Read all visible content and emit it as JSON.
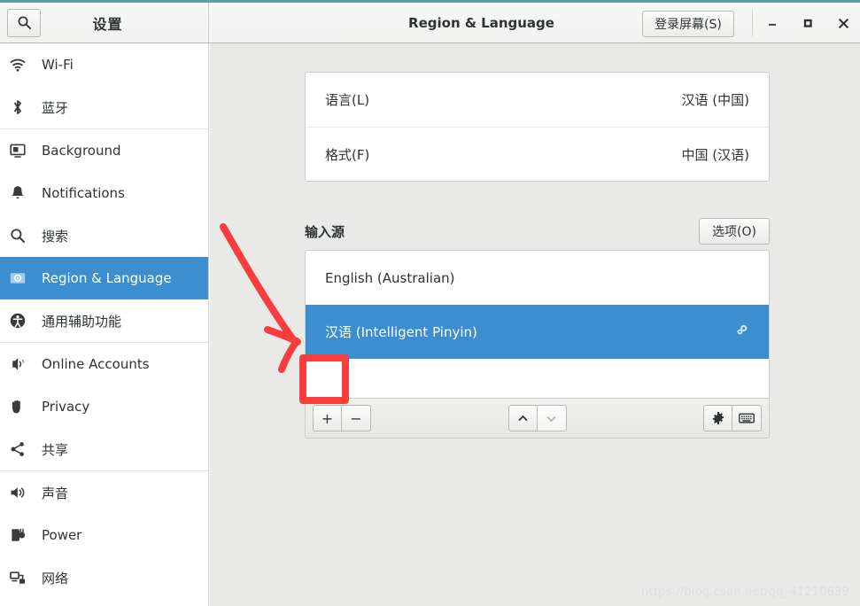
{
  "window": {
    "accent_color": "#5f9ea0",
    "selection_color": "#3c8ecf",
    "settings_title": "设置",
    "page_title": "Region & Language",
    "login_screen_button": "登录屏幕(S)",
    "minimize_label": "–",
    "maximize_label": "■",
    "close_label": "✕"
  },
  "sidebar": {
    "items": [
      {
        "label": "Wi-Fi",
        "icon": "wifi-icon",
        "selected": false,
        "sep_after": false
      },
      {
        "label": "蓝牙",
        "icon": "bluetooth-icon",
        "selected": false,
        "sep_after": true
      },
      {
        "label": "Background",
        "icon": "background-icon",
        "selected": false,
        "sep_after": false
      },
      {
        "label": "Notifications",
        "icon": "bell-icon",
        "selected": false,
        "sep_after": false
      },
      {
        "label": "搜索",
        "icon": "search-icon",
        "selected": false,
        "sep_after": false
      },
      {
        "label": "Region & Language",
        "icon": "region-language-icon",
        "selected": true,
        "sep_after": false
      },
      {
        "label": "通用辅助功能",
        "icon": "accessibility-icon",
        "selected": false,
        "sep_after": true
      },
      {
        "label": "Online Accounts",
        "icon": "online-accounts-icon",
        "selected": false,
        "sep_after": false
      },
      {
        "label": "Privacy",
        "icon": "privacy-hand-icon",
        "selected": false,
        "sep_after": false
      },
      {
        "label": "共享",
        "icon": "sharing-icon",
        "selected": false,
        "sep_after": true
      },
      {
        "label": "声音",
        "icon": "sound-icon",
        "selected": false,
        "sep_after": false
      },
      {
        "label": "Power",
        "icon": "power-plug-icon",
        "selected": false,
        "sep_after": false
      },
      {
        "label": "网络",
        "icon": "network-icon",
        "selected": false,
        "sep_after": false
      }
    ]
  },
  "main": {
    "language_rows": [
      {
        "label": "语言(L)",
        "value": "汉语 (中国)"
      },
      {
        "label": "格式(F)",
        "value": "中国 (汉语)"
      }
    ],
    "input_sources": {
      "section_title": "输入源",
      "options_button": "选项(O)",
      "rows": [
        {
          "label": "English (Australian)",
          "selected": false,
          "has_prefs_icon": false
        },
        {
          "label": "汉语 (Intelligent Pinyin)",
          "selected": true,
          "has_prefs_icon": true
        }
      ],
      "toolbar": {
        "add_label": "+",
        "remove_label": "−",
        "move_up_label": "⌃",
        "move_down_label": "⌄",
        "preferences_icon": "gear-icon",
        "keyboard_icon": "keyboard-icon"
      }
    }
  },
  "annotation": {
    "color": "#f93d3d",
    "type": "hand-drawn-arrow-and-box",
    "target": "add-input-source-button"
  },
  "watermark": {
    "text": "https://blog.csdn.net/qq_41210639"
  }
}
